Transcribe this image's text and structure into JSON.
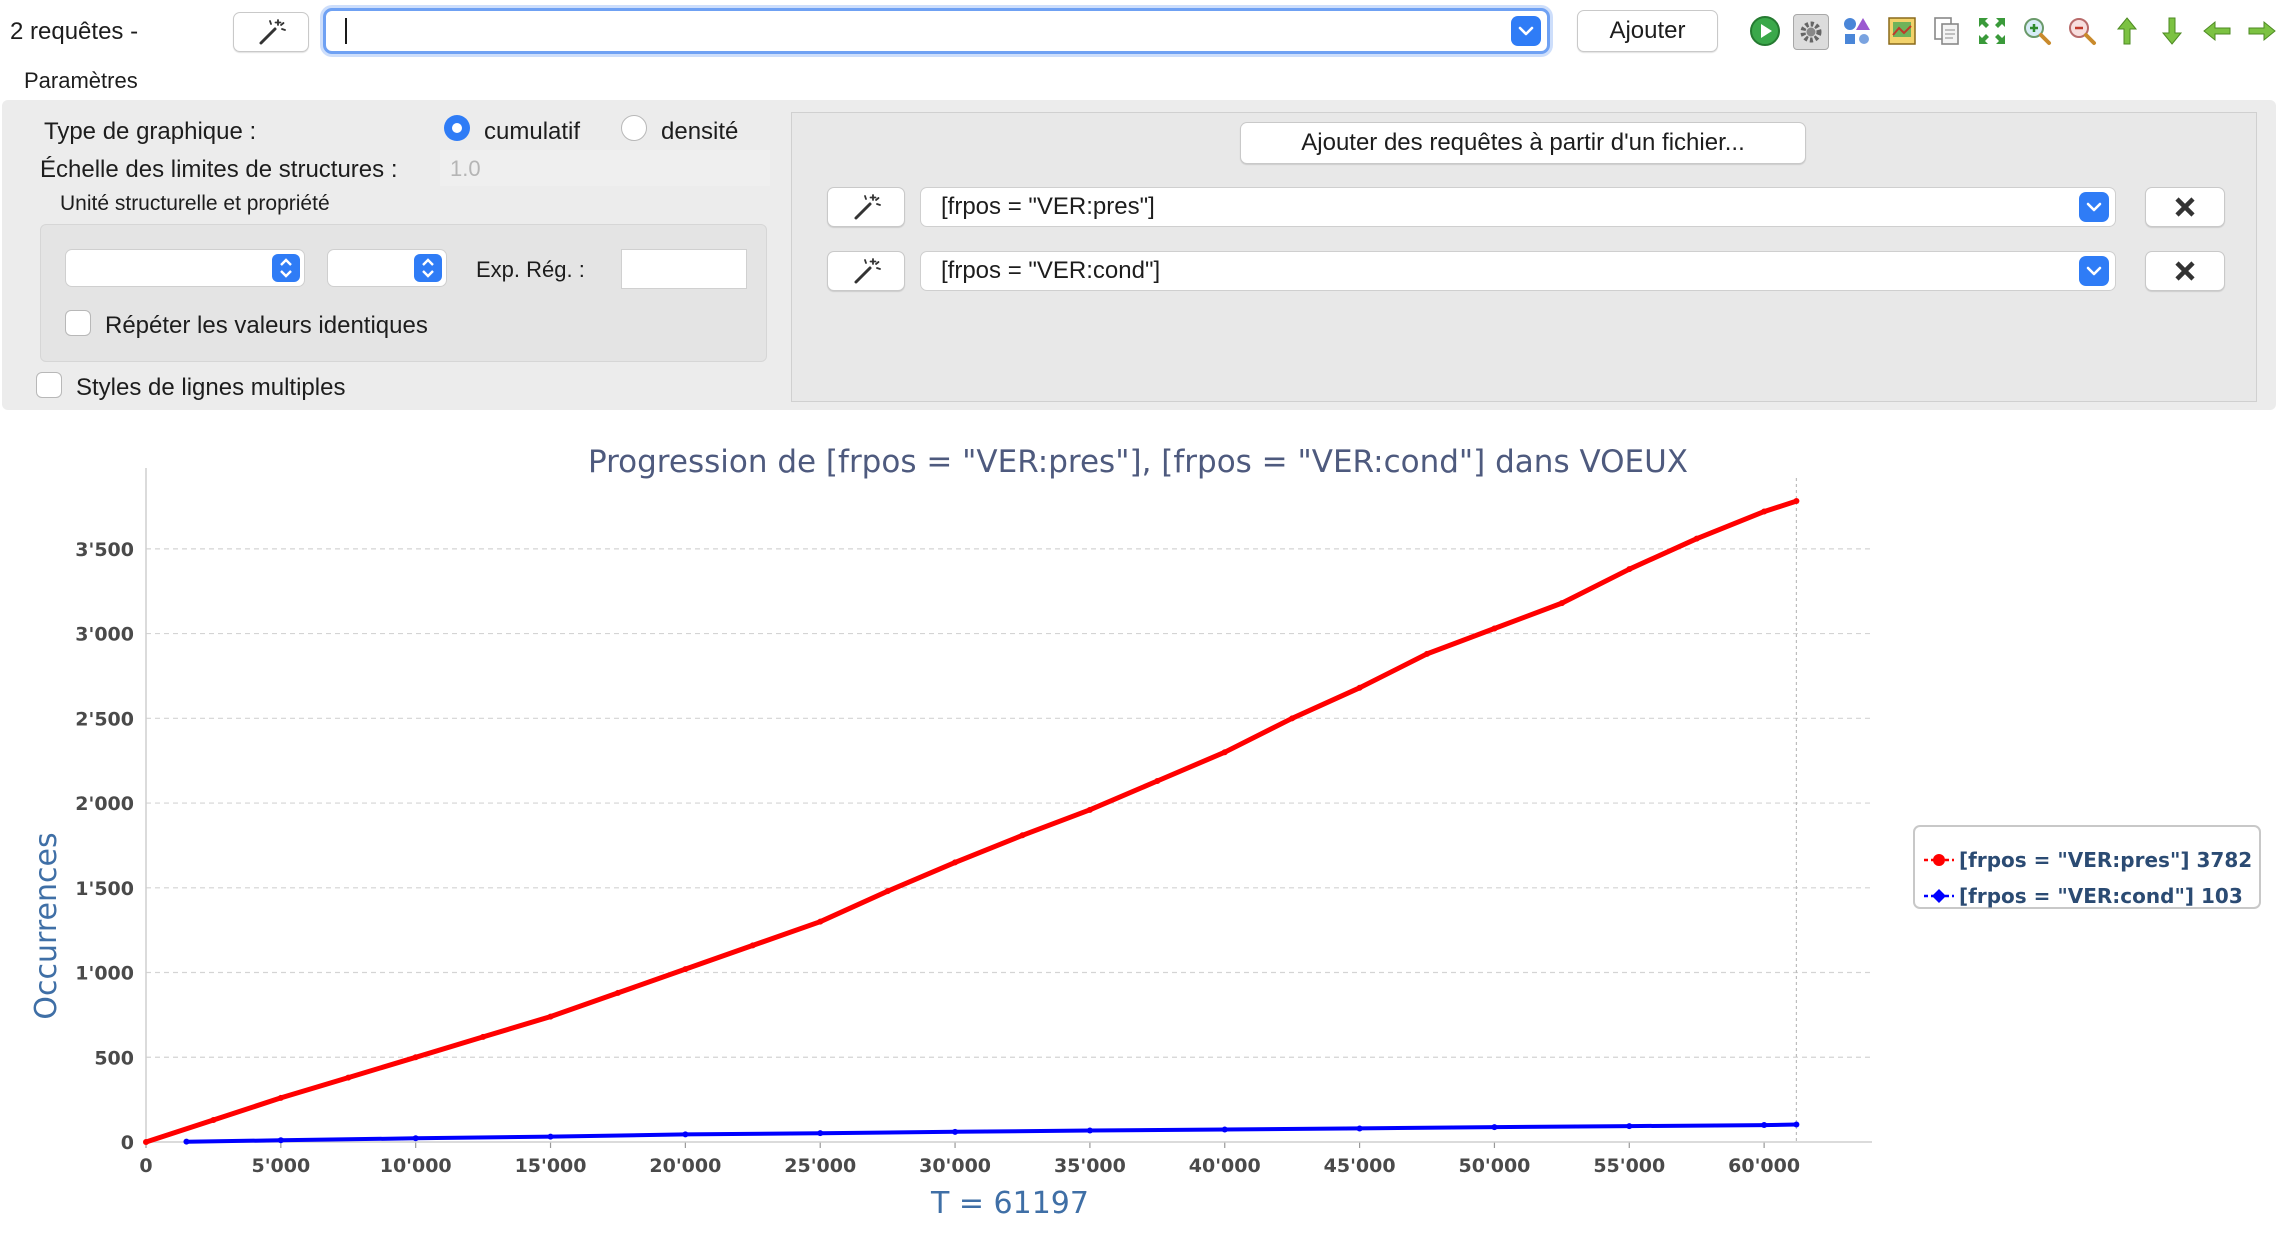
{
  "toolbar": {
    "query_count": "2 requêtes -",
    "main_query_value": "",
    "add_label": "Ajouter",
    "icons": [
      "run-icon",
      "settings-icon",
      "shapes-icon",
      "export-image-icon",
      "copy-icon",
      "fit-icon",
      "zoom-in-icon",
      "zoom-out-icon",
      "arrow-up-icon",
      "arrow-down-icon",
      "arrow-left-icon",
      "arrow-right-icon"
    ]
  },
  "params": {
    "section_label": "Paramètres",
    "chart_type_label": "Type de graphique :",
    "option_cumulative": "cumulatif",
    "option_density": "densité",
    "selected_option": "cumulatif",
    "scale_label": "Échelle des limites de structures :",
    "scale_placeholder": "1.0",
    "structure_group_label": "Unité structurelle et propriété",
    "regex_label": "Exp. Rég. :",
    "repeat_label": "Répéter les valeurs identiques",
    "repeat_checked": false,
    "multi_style_label": "Styles de lignes multiples",
    "multi_style_checked": false
  },
  "queries": {
    "add_from_file_label": "Ajouter des requêtes à partir d'un fichier...",
    "items": [
      {
        "value": "[frpos = \"VER:pres\"]"
      },
      {
        "value": "[frpos = \"VER:cond\"]"
      }
    ]
  },
  "chart_data": {
    "type": "line",
    "title": "Progression de [frpos = \"VER:pres\"], [frpos = \"VER:cond\"] dans VOEUX",
    "xlabel": "T = 61197",
    "ylabel": "Occurrences",
    "xlim": [
      0,
      64000
    ],
    "ylim": [
      0,
      3800
    ],
    "x_ticks": [
      "0",
      "5'000",
      "10'000",
      "15'000",
      "20'000",
      "25'000",
      "30'000",
      "35'000",
      "40'000",
      "45'000",
      "50'000",
      "55'000",
      "60'000"
    ],
    "y_ticks": [
      "0",
      "500",
      "1'000",
      "1'500",
      "2'000",
      "2'500",
      "3'000",
      "3'500"
    ],
    "x_tick_values": [
      0,
      5000,
      10000,
      15000,
      20000,
      25000,
      30000,
      35000,
      40000,
      45000,
      50000,
      55000,
      60000
    ],
    "y_tick_values": [
      0,
      500,
      1000,
      1500,
      2000,
      2500,
      3000,
      3500
    ],
    "end_marker_x": 61197,
    "grid": true,
    "legend_position": "right",
    "series": [
      {
        "name": "[frpos = \"VER:pres\"] 3782",
        "color": "#ff0000",
        "x": [
          0,
          2500,
          5000,
          7500,
          10000,
          12500,
          15000,
          17500,
          20000,
          22500,
          25000,
          27500,
          30000,
          32500,
          35000,
          37500,
          40000,
          42500,
          45000,
          47500,
          50000,
          52500,
          55000,
          57500,
          60000,
          61197
        ],
        "y": [
          0,
          130,
          260,
          380,
          500,
          620,
          740,
          880,
          1020,
          1160,
          1300,
          1480,
          1650,
          1810,
          1960,
          2130,
          2300,
          2500,
          2680,
          2880,
          3030,
          3180,
          3380,
          3560,
          3720,
          3782
        ]
      },
      {
        "name": "[frpos = \"VER:cond\"] 103",
        "color": "#0000ff",
        "x": [
          1500,
          5000,
          10000,
          15000,
          20000,
          25000,
          30000,
          35000,
          40000,
          45000,
          50000,
          55000,
          60000,
          61197
        ],
        "y": [
          2,
          10,
          22,
          32,
          45,
          52,
          60,
          68,
          74,
          80,
          88,
          94,
          100,
          103
        ]
      }
    ]
  }
}
